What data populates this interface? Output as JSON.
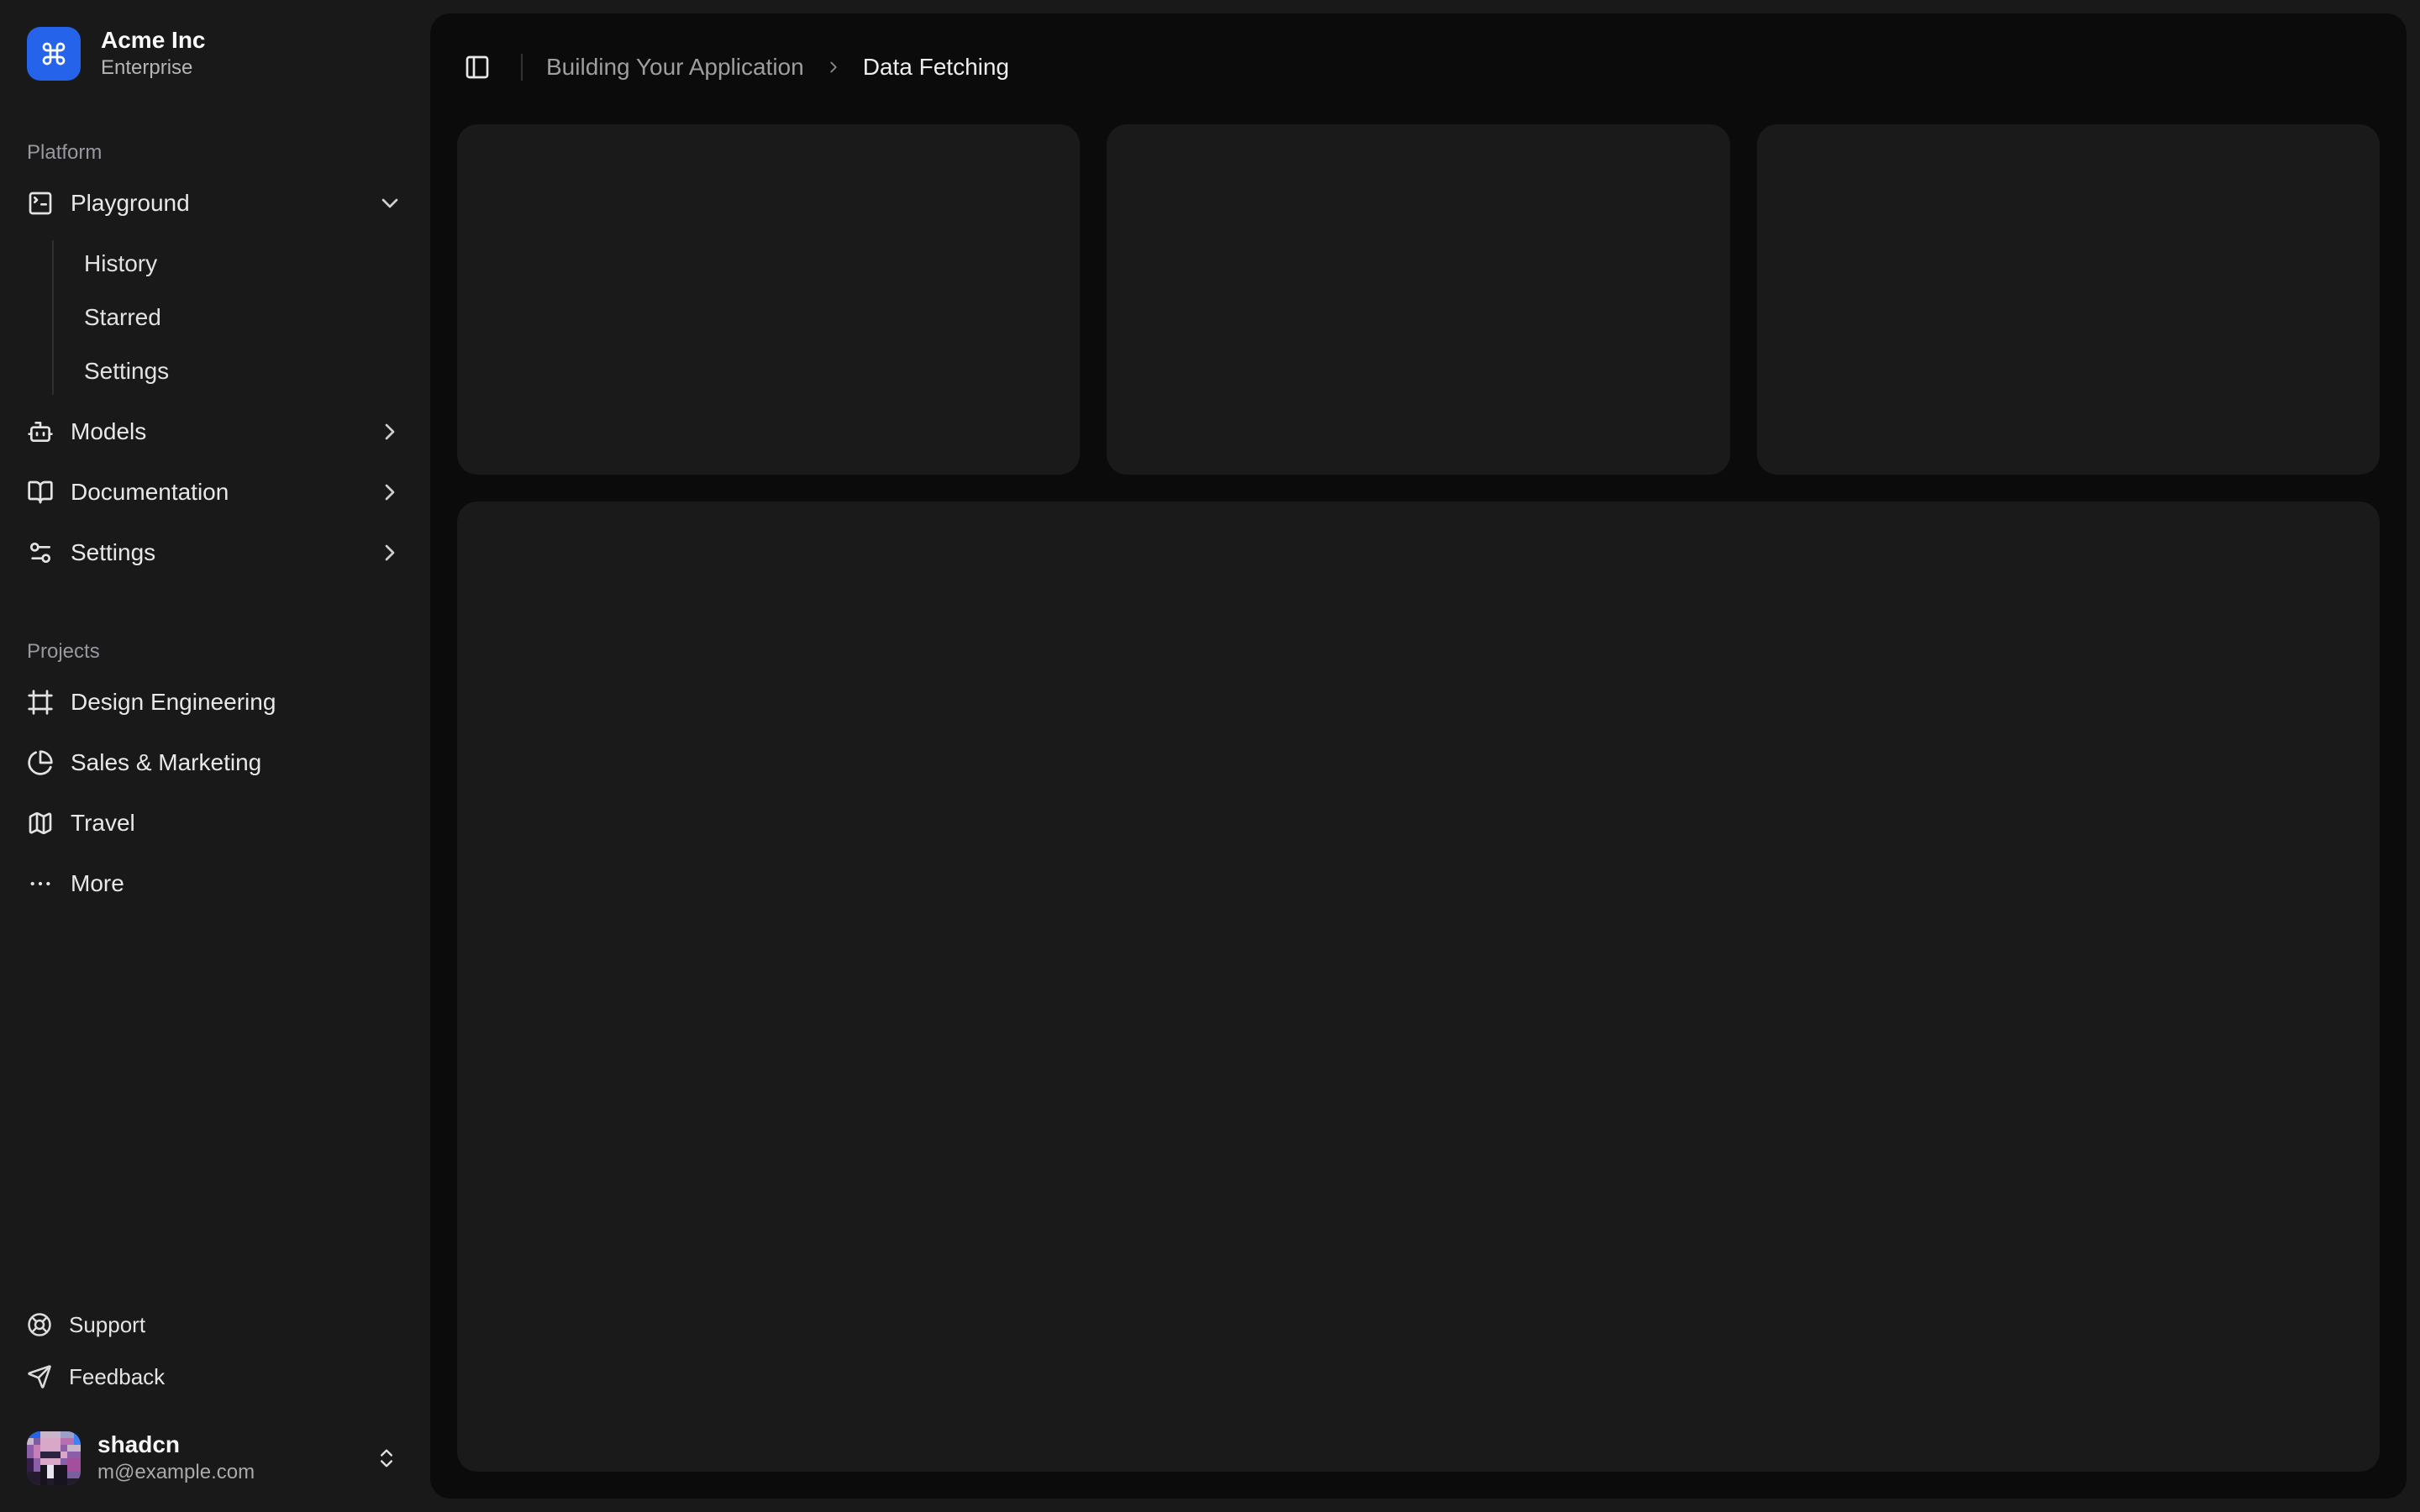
{
  "brand": {
    "name": "Acme Inc",
    "plan": "Enterprise",
    "logo_icon": "command-icon",
    "accent_color": "#2563eb"
  },
  "sidebar": {
    "groups": [
      {
        "label": "Platform",
        "items": [
          {
            "label": "Playground",
            "icon": "square-terminal-icon",
            "state": "expanded",
            "children": [
              {
                "label": "History"
              },
              {
                "label": "Starred"
              },
              {
                "label": "Settings"
              }
            ]
          },
          {
            "label": "Models",
            "icon": "bot-icon"
          },
          {
            "label": "Documentation",
            "icon": "book-open-icon"
          },
          {
            "label": "Settings",
            "icon": "sliders-icon"
          }
        ]
      },
      {
        "label": "Projects",
        "items": [
          {
            "label": "Design Engineering",
            "icon": "frame-icon"
          },
          {
            "label": "Sales & Marketing",
            "icon": "pie-chart-icon"
          },
          {
            "label": "Travel",
            "icon": "map-icon"
          },
          {
            "label": "More",
            "icon": "ellipsis-icon"
          }
        ]
      }
    ],
    "secondary": [
      {
        "label": "Support",
        "icon": "life-buoy-icon"
      },
      {
        "label": "Feedback",
        "icon": "send-icon"
      }
    ],
    "user": {
      "name": "shadcn",
      "email": "m@example.com"
    }
  },
  "header": {
    "sidebar_toggle_icon": "panel-left-icon",
    "breadcrumb": {
      "section": "Building Your Application",
      "page": "Data Fetching"
    }
  },
  "colors": {
    "body_background": "#191919",
    "panel_background": "#0b0b0b",
    "card_background": "#1a1a1a",
    "accent_blue": "#2563eb"
  }
}
